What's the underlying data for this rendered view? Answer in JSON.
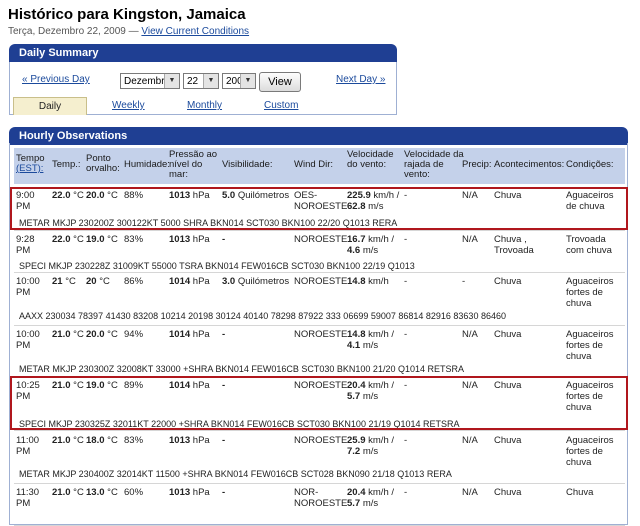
{
  "header": {
    "title": "Histórico para Kingston, Jamaica",
    "date_text": "Terça, Dezembro 22, 2009 —",
    "current_link": "View Current Conditions"
  },
  "daily_summary": {
    "title": "Daily Summary",
    "prev_label": "« Previous Day",
    "next_label": "Next Day »",
    "month": "Dezembro",
    "day": "22",
    "year": "2009",
    "view_label": "View",
    "tabs": [
      "Daily",
      "Weekly",
      "Monthly",
      "Custom"
    ]
  },
  "hourly": {
    "title": "Hourly Observations",
    "headers": {
      "time": "Tempo",
      "time_unit": "(EST):",
      "temp": "Temp.:",
      "dew": "Ponto orvalho:",
      "hum": "Humidade:",
      "press": "Pressão ao nível do mar:",
      "vis": "Visibilidade:",
      "wdir": "Wind Dir:",
      "wspd": "Velocidade do vento:",
      "gust": "Velocidade da rajada de vento:",
      "precip": "Precip:",
      "events": "Acontecimentos:",
      "cond": "Condições:"
    },
    "rows": [
      {
        "time": "9:00 PM",
        "temp": "22.0",
        "temp_u": "°C",
        "dew": "20.0",
        "dew_u": "°C",
        "hum": "88%",
        "press": "1013",
        "press_u": "hPa",
        "vis": "5.0",
        "vis_u": "Quilómetros",
        "wdir": "OES-NOROESTE",
        "wspd1": "225.9",
        "wspd1_u": "km/h /",
        "wspd2": "62.8",
        "wspd2_u": "m/s",
        "gust": "-",
        "precip": "N/A",
        "events": "Chuva",
        "cond": "Aguaceiros de chuva",
        "metar": "METAR MKJP 230200Z 300122KT 5000 SHRA BKN014 SCT030 BKN100 22/20 Q1013 RERA"
      },
      {
        "time": "9:28 PM",
        "temp": "22.0",
        "temp_u": "°C",
        "dew": "19.0",
        "dew_u": "°C",
        "hum": "83%",
        "press": "1013",
        "press_u": "hPa",
        "vis": "-",
        "vis_u": "",
        "wdir": "NOROESTE",
        "wspd1": "16.7",
        "wspd1_u": "km/h /",
        "wspd2": "4.6",
        "wspd2_u": "m/s",
        "gust": "-",
        "precip": "N/A",
        "events": "Chuva , Trovoada",
        "cond": "Trovoada com chuva",
        "metar": "SPECI MKJP 230228Z 31009KT 55000 TSRA BKN014 FEW016CB SCT030 BKN100 22/19 Q1013"
      },
      {
        "time": "10:00 PM",
        "temp": "21",
        "temp_u": "°C",
        "dew": "20",
        "dew_u": "°C",
        "hum": "86%",
        "press": "1014",
        "press_u": "hPa",
        "vis": "3.0",
        "vis_u": "Quilómetros",
        "wdir": "NOROESTE",
        "wspd1": "14.8",
        "wspd1_u": "km/h",
        "wspd2": "",
        "wspd2_u": "",
        "gust": "-",
        "precip": "-",
        "events": "Chuva",
        "cond": "Aguaceiros fortes de chuva",
        "metar": "AAXX 230034 78397 41430 83208 10214 20198 30124 40140 78298 87922 333 06699 59007 86814 82916 83630 86460"
      },
      {
        "time": "10:00 PM",
        "temp": "21.0",
        "temp_u": "°C",
        "dew": "20.0",
        "dew_u": "°C",
        "hum": "94%",
        "press": "1014",
        "press_u": "hPa",
        "vis": "-",
        "vis_u": "",
        "wdir": "NOROESTE",
        "wspd1": "14.8",
        "wspd1_u": "km/h /",
        "wspd2": "4.1",
        "wspd2_u": "m/s",
        "gust": "-",
        "precip": "N/A",
        "events": "Chuva",
        "cond": "Aguaceiros fortes de chuva",
        "metar": "METAR MKJP 230300Z 32008KT 33000 +SHRA BKN014 FEW016CB SCT030 BKN100 21/20 Q1014 RETSRA"
      },
      {
        "time": "10:25 PM",
        "temp": "21.0",
        "temp_u": "°C",
        "dew": "19.0",
        "dew_u": "°C",
        "hum": "89%",
        "press": "1014",
        "press_u": "hPa",
        "vis": "-",
        "vis_u": "",
        "wdir": "NOROESTE",
        "wspd1": "20.4",
        "wspd1_u": "km/h /",
        "wspd2": "5.7",
        "wspd2_u": "m/s",
        "gust": "-",
        "precip": "N/A",
        "events": "Chuva",
        "cond": "Aguaceiros fortes de chuva",
        "metar": "SPECI MKJP 230325Z 32011KT 22000 +SHRA BKN014 FEW016CB SCT030 BKN100 21/19 Q1014 RETSRA"
      },
      {
        "time": "11:00 PM",
        "temp": "21.0",
        "temp_u": "°C",
        "dew": "18.0",
        "dew_u": "°C",
        "hum": "83%",
        "press": "1013",
        "press_u": "hPa",
        "vis": "-",
        "vis_u": "",
        "wdir": "NOROESTE",
        "wspd1": "25.9",
        "wspd1_u": "km/h /",
        "wspd2": "7.2",
        "wspd2_u": "m/s",
        "gust": "-",
        "precip": "N/A",
        "events": "Chuva",
        "cond": "Aguaceiros fortes de chuva",
        "metar": "METAR MKJP 230400Z 32014KT 11500 +SHRA BKN014 FEW016CB SCT028 BKN090 21/18 Q1013 RERA"
      },
      {
        "time": "11:30 PM",
        "temp": "21.0",
        "temp_u": "°C",
        "dew": "13.0",
        "dew_u": "°C",
        "hum": "60%",
        "press": "1013",
        "press_u": "hPa",
        "vis": "-",
        "vis_u": "",
        "wdir": "NOR-NOROESTE",
        "wspd1": "20.4",
        "wspd1_u": "km/h /",
        "wspd2": "5.7",
        "wspd2_u": "m/s",
        "gust": "-",
        "precip": "N/A",
        "events": "Chuva",
        "cond": "Chuva",
        "metar": ""
      }
    ]
  }
}
